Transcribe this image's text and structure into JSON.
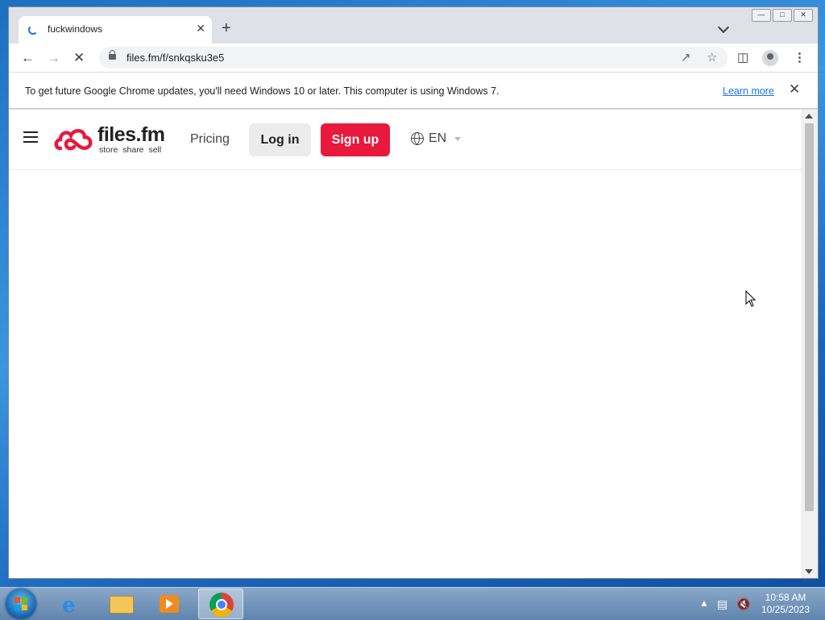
{
  "browser": {
    "tab": {
      "title": "fuckwindows",
      "close": "✕"
    },
    "new_tab": "+",
    "url": "files.fm/f/snkqsku3e5",
    "infobar": {
      "message": "To get future Google Chrome updates, you'll need Windows 10 or later. This computer is using Windows 7.",
      "learn_more": "Learn more",
      "close": "✕"
    }
  },
  "site": {
    "logo_name": "files.fm",
    "logo_tagline": "store share sell",
    "nav_pricing": "Pricing",
    "login": "Log in",
    "signup": "Sign up",
    "language": "EN"
  },
  "taskbar": {
    "time": "10:58 AM",
    "date": "10/25/2023"
  },
  "colors": {
    "accent": "#e8193c",
    "link": "#1a73e8"
  }
}
